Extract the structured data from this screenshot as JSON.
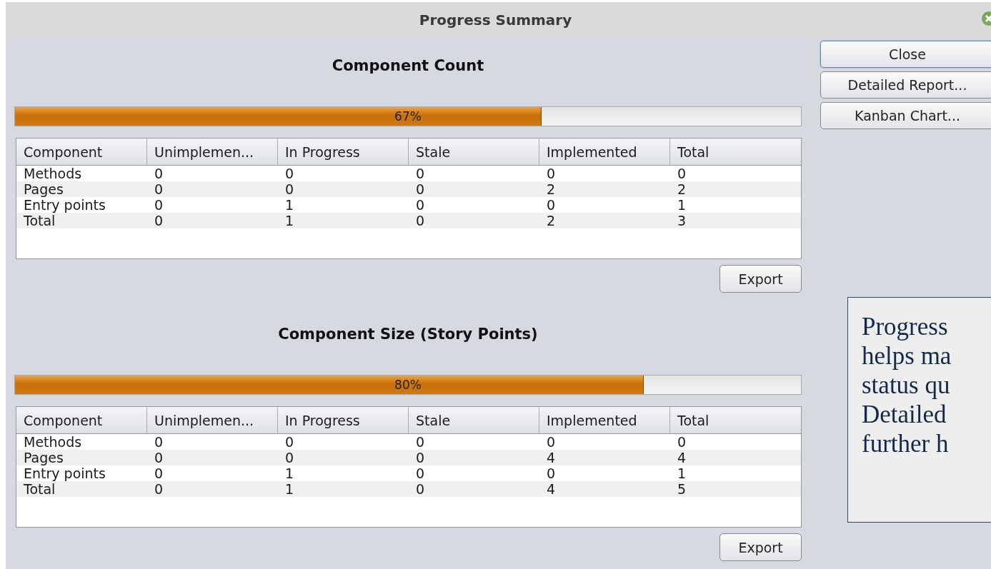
{
  "window": {
    "title": "Progress Summary"
  },
  "sections": [
    {
      "heading": "Component Count",
      "progress": {
        "level": 0.67,
        "label": "67%"
      },
      "columns": [
        "Component",
        "Unimplemen...",
        "In Progress",
        "Stale",
        "Implemented",
        "Total"
      ],
      "rows": [
        [
          "Methods",
          "0",
          "0",
          "0",
          "0",
          "0"
        ],
        [
          "Pages",
          "0",
          "0",
          "0",
          "2",
          "2"
        ],
        [
          "Entry points",
          "0",
          "1",
          "0",
          "0",
          "1"
        ],
        [
          "Total",
          "0",
          "1",
          "0",
          "2",
          "3"
        ]
      ],
      "export_button": "Export"
    },
    {
      "heading": "Component Size (Story Points)",
      "progress": {
        "level": 0.8,
        "label": "80%"
      },
      "columns": [
        "Component",
        "Unimplemen...",
        "In Progress",
        "Stale",
        "Implemented",
        "Total"
      ],
      "rows": [
        [
          "Methods",
          "0",
          "0",
          "0",
          "0",
          "0"
        ],
        [
          "Pages",
          "0",
          "0",
          "0",
          "4",
          "4"
        ],
        [
          "Entry points",
          "0",
          "1",
          "0",
          "0",
          "1"
        ],
        [
          "Total",
          "0",
          "1",
          "0",
          "4",
          "5"
        ]
      ],
      "export_button": "Export"
    }
  ],
  "buttons": [
    {
      "label": "Close",
      "focused": true
    },
    {
      "label": "Detailed Report...",
      "focused": false
    },
    {
      "label": "Kanban Chart...",
      "focused": false
    }
  ],
  "callout": {
    "text": "Progress\nhelps ma\nstatus qu\nDetailed\nfurther h"
  }
}
